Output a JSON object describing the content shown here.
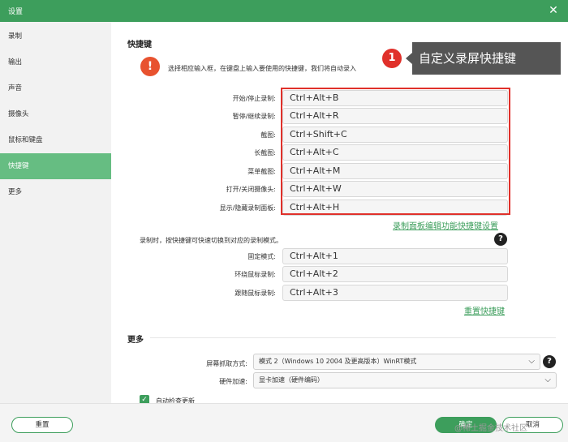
{
  "window": {
    "title": "设置",
    "close_glyph": "✕"
  },
  "sidebar": {
    "items": [
      {
        "label": "录制"
      },
      {
        "label": "输出"
      },
      {
        "label": "声音"
      },
      {
        "label": "摄像头"
      },
      {
        "label": "鼠标和键盘"
      },
      {
        "label": "快捷键",
        "active": true
      },
      {
        "label": "更多"
      }
    ]
  },
  "shortcuts": {
    "title": "快捷键",
    "hint": "选择相应输入框，在键盘上输入要使用的快捷键，我们将自动录入",
    "rows": [
      {
        "label": "开始/停止录制:",
        "value": "Ctrl+Alt+B"
      },
      {
        "label": "暂停/继续录制:",
        "value": "Ctrl+Alt+R"
      },
      {
        "label": "截图:",
        "value": "Ctrl+Shift+C"
      },
      {
        "label": "长截图:",
        "value": "Ctrl+Alt+C"
      },
      {
        "label": "菜单截图:",
        "value": "Ctrl+Alt+M"
      },
      {
        "label": "打开/关闭摄像头:",
        "value": "Ctrl+Alt+W"
      },
      {
        "label": "显示/隐藏录制面板:",
        "value": "Ctrl+Alt+H"
      }
    ],
    "panel_link": "录制面板编辑功能快捷键设置",
    "mode_hint": "录制时，按快捷键可快速切换到对应的录制模式。",
    "mode_rows": [
      {
        "label": "固定模式:",
        "value": "Ctrl+Alt+1"
      },
      {
        "label": "环绕鼠标录制:",
        "value": "Ctrl+Alt+2"
      },
      {
        "label": "跟随鼠标录制:",
        "value": "Ctrl+Alt+3"
      }
    ],
    "reset_link": "重置快捷键"
  },
  "more": {
    "title": "更多",
    "capture_label": "屏幕抓取方式:",
    "capture_value": "模式 2（Windows 10 2004 及更高版本）WinRT模式",
    "accel_label": "硬件加速:",
    "accel_value": "显卡加速（硬件编码）",
    "auto_update_label": "自动检查更新"
  },
  "footer": {
    "reset": "重置",
    "ok": "确定",
    "cancel": "取消",
    "watermark": "@稀土掘金技术社区"
  },
  "callout": {
    "number": "1",
    "text": "自定义录屏快捷键"
  },
  "icons": {
    "warn": "!",
    "help": "?",
    "chevron": "⌵",
    "check": "✓"
  },
  "colors": {
    "accent": "#3d9e5c",
    "sidebar_active": "#66bd82",
    "highlight": "#e0302a"
  }
}
